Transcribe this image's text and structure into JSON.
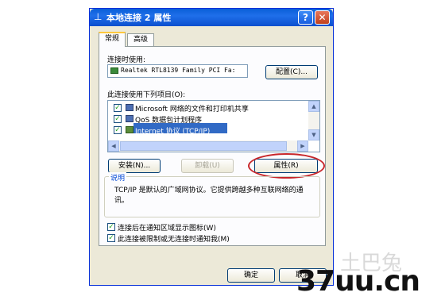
{
  "window": {
    "title": "本地连接 2 属性",
    "help_glyph": "?",
    "close_glyph": "✕"
  },
  "tabs": [
    {
      "label": "常规"
    },
    {
      "label": "高级"
    }
  ],
  "connect_using": {
    "label": "连接时使用:",
    "device": "Realtek RTL8139 Family PCI Fa:",
    "configure_button": "配置(C)..."
  },
  "components": {
    "label": "此连接使用下列项目(O):",
    "items": [
      {
        "label": "Microsoft 网络的文件和打印机共享",
        "checked": true,
        "selected": false
      },
      {
        "label": "QoS 数据包计划程序",
        "checked": true,
        "selected": false
      },
      {
        "label": "Internet 协议 (TCP/IP)",
        "checked": true,
        "selected": true
      }
    ]
  },
  "action_buttons": {
    "install": "安装(N)...",
    "uninstall": "卸载(U)",
    "properties": "属性(R)"
  },
  "description": {
    "title": "说明",
    "text": "TCP/IP 是默认的广域网协议。它提供跨越多种互联网络的通讯。"
  },
  "options": [
    {
      "label": "连接后在通知区域显示图标(W)",
      "checked": true
    },
    {
      "label": "此连接被限制或无连接时通知我(M)",
      "checked": true
    }
  ],
  "footer_buttons": {
    "ok": "确定",
    "cancel": "取消"
  },
  "watermark": {
    "site": "37uu.cn",
    "faded_text": "土巴兔"
  },
  "colors": {
    "title_bar": "#0a5fd8",
    "dialog_bg": "#ece9d8",
    "selection": "#316ac5",
    "highlight_circle": "#c8262a",
    "active_tab_accent": "#ffc83c"
  }
}
